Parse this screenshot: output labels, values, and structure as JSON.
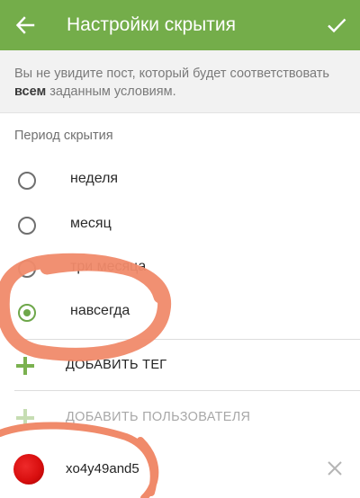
{
  "header": {
    "title": "Настройки скрытия",
    "back_icon": "arrow-back-icon",
    "confirm_icon": "check-icon",
    "background_color": "#74ad4a"
  },
  "info": {
    "text_before": "Вы не увидите пост, который будет соответствовать",
    "text_bold": "всем",
    "text_after": "заданным условиям."
  },
  "period": {
    "label": "Период скрытия",
    "options": [
      {
        "label": "неделя",
        "checked": false
      },
      {
        "label": "месяц",
        "checked": false
      },
      {
        "label": "три месяца",
        "checked": false
      },
      {
        "label": "навсегда",
        "checked": true
      }
    ]
  },
  "actions": {
    "add_tag": "ДОБАВИТЬ ТЕГ",
    "add_user": "ДОБАВИТЬ ПОЛЬЗОВАТЕЛЯ"
  },
  "user": {
    "name": "xo4y49and5",
    "remove_icon": "close-icon"
  },
  "colors": {
    "accent": "#6ea74a",
    "annotation": "#f08a6a"
  }
}
